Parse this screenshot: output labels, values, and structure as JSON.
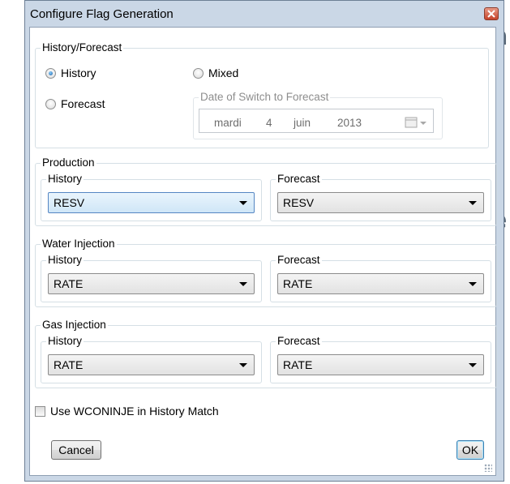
{
  "background_fragments": [
    "n",
    "e"
  ],
  "dialog": {
    "title": "Configure Flag Generation",
    "close_icon": "close-icon"
  },
  "history_forecast": {
    "label": "History/Forecast",
    "options": [
      {
        "label": "History",
        "checked": true
      },
      {
        "label": "Mixed",
        "checked": false
      },
      {
        "label": "Forecast",
        "checked": false
      }
    ],
    "date_switch": {
      "label": "Date of Switch to Forecast",
      "day_name": "mardi",
      "day": "4",
      "month": "juin",
      "year": "2013",
      "icon": "calendar-dropdown-icon"
    }
  },
  "production": {
    "label": "Production",
    "history": {
      "label": "History",
      "value": "RESV"
    },
    "forecast": {
      "label": "Forecast",
      "value": "RESV"
    }
  },
  "water_injection": {
    "label": "Water Injection",
    "history": {
      "label": "History",
      "value": "RATE"
    },
    "forecast": {
      "label": "Forecast",
      "value": "RATE"
    }
  },
  "gas_injection": {
    "label": "Gas Injection",
    "history": {
      "label": "History",
      "value": "RATE"
    },
    "forecast": {
      "label": "Forecast",
      "value": "RATE"
    }
  },
  "use_wconinje": {
    "label": "Use WCONINJE in History Match",
    "checked": false
  },
  "buttons": {
    "cancel": "Cancel",
    "ok": "OK"
  },
  "colors": {
    "title_bar": "#cad7e6",
    "focus_blue": "#5586c3",
    "close_red": "#c5422a"
  }
}
